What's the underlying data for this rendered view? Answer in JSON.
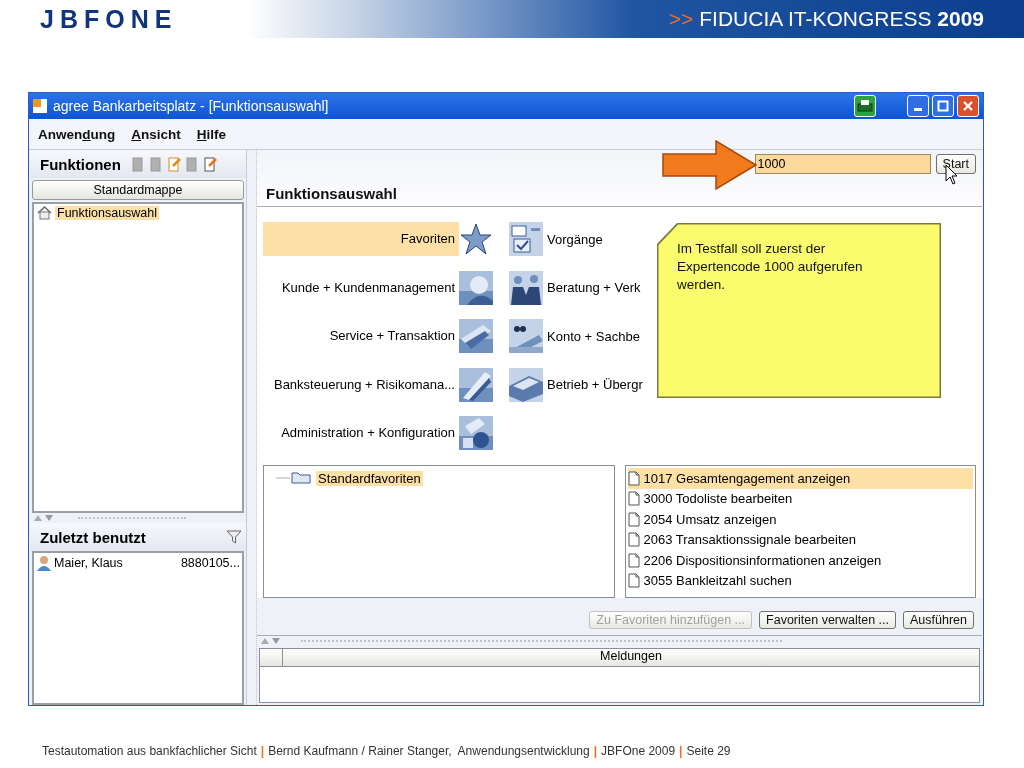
{
  "slide_header": {
    "logo": "JBFONE",
    "prefix": ">>",
    "title": "FIDUCIA IT-KONGRESS **2009**"
  },
  "window": {
    "title": "agree Bankarbeitsplatz - [Funktionsauswahl]"
  },
  "menu": [
    {
      "before": "Anwen",
      "key": "d",
      "after": "ung"
    },
    {
      "key": "A",
      "after": "nsicht"
    },
    {
      "key": "H",
      "after": "ilfe"
    }
  ],
  "functions_panel": {
    "title": "Funktionen",
    "tools": [
      {
        "disabled": true
      },
      {
        "disabled": true
      },
      {
        "disabled": false
      },
      {
        "disabled": true
      },
      {
        "disabled": false
      }
    ],
    "folder_button": "Standardmappe",
    "tree": [
      {
        "label": "Funktionsauswahl",
        "selected": true
      }
    ]
  },
  "recent_panel": {
    "title": "Zuletzt benutzt",
    "rows": [
      {
        "name": "Maier, Klaus",
        "number": "8880105..."
      }
    ]
  },
  "code_search": {
    "value": "1000",
    "button": "Start"
  },
  "heading": "Funktionsauswahl",
  "categories_left": [
    {
      "label": "Favoriten",
      "selected": true
    },
    {
      "label": "Kunde + Kundenmanagement",
      "selected": false
    },
    {
      "label": "Service + Transaktion",
      "selected": false
    },
    {
      "label": "Banksteuerung + Risikomana...",
      "selected": false
    },
    {
      "label": "Administration + Konfiguration",
      "selected": false
    }
  ],
  "categories_right": [
    {
      "label": "Vorgänge",
      "selected": false
    },
    {
      "label": "Beratung + Verk",
      "selected": false
    },
    {
      "label": "Konto + Sachbe",
      "selected": false
    },
    {
      "label": "Betrieb + Übergr",
      "selected": false
    }
  ],
  "note": {
    "text": "Im Testfall soll zuerst der Expertencode 1000 aufgerufen werden."
  },
  "favorites_tree": [
    {
      "label": "Standardfavoriten",
      "selected": true
    }
  ],
  "favorites_list": [
    {
      "label": "1017 Gesamtengagement anzeigen",
      "selected": true
    },
    {
      "label": "3000 Todoliste bearbeiten",
      "selected": false
    },
    {
      "label": "2054 Umsatz anzeigen",
      "selected": false
    },
    {
      "label": "2063 Transaktionssignale bearbeiten",
      "selected": false
    },
    {
      "label": "2206 Dispositionsinformationen anzeigen",
      "selected": false
    },
    {
      "label": "3055 Bankleitzahl suchen",
      "selected": false
    }
  ],
  "buttons": [
    {
      "label": "Zu Favoriten hinzufügen ...",
      "disabled": true
    },
    {
      "label": "Favoriten verwalten ...",
      "disabled": false
    },
    {
      "label": "Ausführen",
      "disabled": false
    }
  ],
  "messages": {
    "columns": [
      "Meldungen"
    ]
  },
  "footer": [
    {
      "text": "Testautomation aus bankfachlicher Sicht",
      "kind": "text"
    },
    {
      "text": "|",
      "kind": "separator"
    },
    {
      "text": "Bernd Kaufmann / Rainer Stanger,  Anwendungsentwicklung",
      "kind": "text"
    },
    {
      "text": "|",
      "kind": "separator"
    },
    {
      "text": "JBFOne 2009",
      "kind": "text"
    },
    {
      "text": "|",
      "kind": "separator"
    },
    {
      "text": "Seite 29",
      "kind": "text"
    }
  ]
}
